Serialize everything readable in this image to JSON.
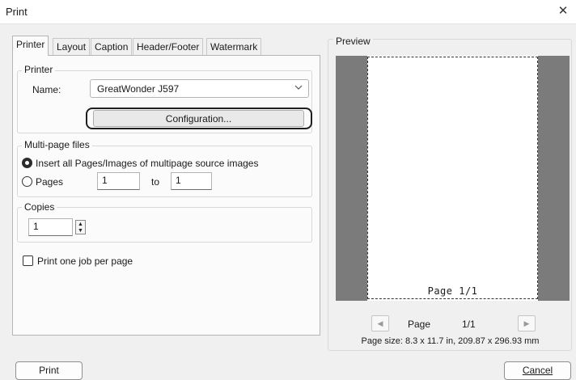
{
  "window": {
    "title": "Print",
    "close_glyph": "✕"
  },
  "tabs": [
    {
      "label": "Printer",
      "active": true
    },
    {
      "label": "Layout"
    },
    {
      "label": "Caption"
    },
    {
      "label": "Header/Footer"
    },
    {
      "label": "Watermark"
    }
  ],
  "printer": {
    "group_label": "Printer",
    "name_label": "Name:",
    "name_value": "GreatWonder J597",
    "config_button": "Configuration..."
  },
  "multipage": {
    "group_label": "Multi-page files",
    "option_all": "Insert all Pages/Images of multipage source images",
    "option_pages": "Pages",
    "selected": "all",
    "from": "1",
    "to_label": "to",
    "to": "1"
  },
  "copies": {
    "group_label": "Copies",
    "value": "1"
  },
  "one_job_per_page": {
    "label": "Print one job per page",
    "checked": false
  },
  "preview": {
    "label": "Preview",
    "page_text": "Page 1/1",
    "nav_page_label": "Page",
    "nav_page_value": "1/1",
    "page_size": "Page size: 8.3 x 11.7 in, 209.87 x 296.93 mm"
  },
  "buttons": {
    "print": "Print",
    "cancel": "Cancel"
  }
}
